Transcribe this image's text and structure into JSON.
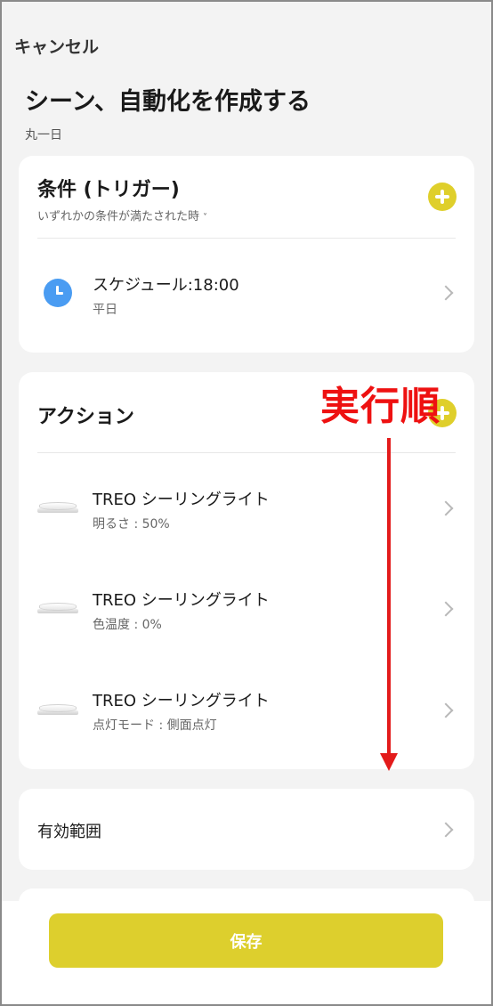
{
  "header": {
    "cancel_label": "キャンセル",
    "title": "シーン、自動化を作成する",
    "subtitle": "丸一日"
  },
  "conditions": {
    "title": "条件 (トリガー)",
    "mode_label": "いずれかの条件が満たされた時",
    "mode_chevron": "˅",
    "items": [
      {
        "icon": "clock-icon",
        "title": "スケジュール:18:00",
        "subtitle": "平日"
      }
    ]
  },
  "actions": {
    "title": "アクション",
    "items": [
      {
        "icon": "ceiling-light-icon",
        "title": "TREO シーリングライト",
        "subtitle": "明るさ : 50%"
      },
      {
        "icon": "ceiling-light-icon",
        "title": "TREO シーリングライト",
        "subtitle": "色温度 : 0%"
      },
      {
        "icon": "ceiling-light-icon",
        "title": "TREO シーリングライト",
        "subtitle": "点灯モード : 側面点灯"
      }
    ]
  },
  "scope": {
    "label": "有効範囲"
  },
  "footer": {
    "save_label": "保存"
  },
  "annotation": {
    "text": "実行順",
    "color": "#e31b1b"
  },
  "colors": {
    "accent": "#ddcf2d",
    "clock": "#4a9cf2",
    "background": "#f3f3f3"
  }
}
